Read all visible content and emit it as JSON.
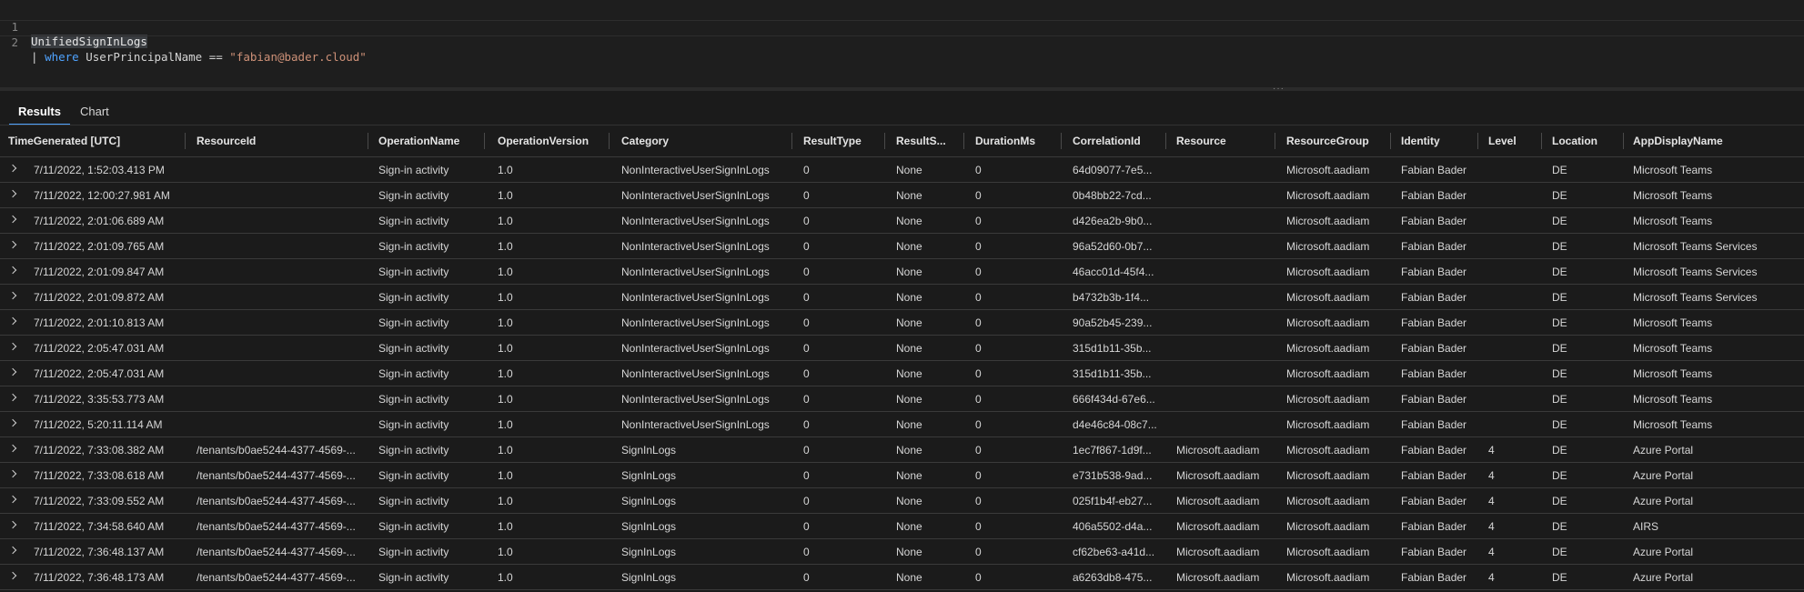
{
  "editor": {
    "lines": [
      {
        "num": "1",
        "table": "UnifiedSignInLogs"
      },
      {
        "num": "2",
        "pipe": "|",
        "keyword": "where",
        "column": "UserPrincipalName",
        "op": "==",
        "string": "\"fabian@bader.cloud\""
      }
    ]
  },
  "tabs": [
    {
      "label": "Results",
      "active": true
    },
    {
      "label": "Chart",
      "active": false
    }
  ],
  "columns": [
    "TimeGenerated [UTC]",
    "ResourceId",
    "OperationName",
    "OperationVersion",
    "Category",
    "ResultType",
    "ResultS...",
    "DurationMs",
    "CorrelationId",
    "Resource",
    "ResourceGroup",
    "Identity",
    "Level",
    "Location",
    "AppDisplayName"
  ],
  "rows": [
    [
      "7/11/2022, 1:52:03.413 PM",
      "",
      "Sign-in activity",
      "1.0",
      "NonInteractiveUserSignInLogs",
      "0",
      "None",
      "0",
      "64d09077-7e5...",
      "",
      "Microsoft.aadiam",
      "Fabian Bader",
      "",
      "DE",
      "Microsoft Teams"
    ],
    [
      "7/11/2022, 12:00:27.981 AM",
      "",
      "Sign-in activity",
      "1.0",
      "NonInteractiveUserSignInLogs",
      "0",
      "None",
      "0",
      "0b48bb22-7cd...",
      "",
      "Microsoft.aadiam",
      "Fabian Bader",
      "",
      "DE",
      "Microsoft Teams"
    ],
    [
      "7/11/2022, 2:01:06.689 AM",
      "",
      "Sign-in activity",
      "1.0",
      "NonInteractiveUserSignInLogs",
      "0",
      "None",
      "0",
      "d426ea2b-9b0...",
      "",
      "Microsoft.aadiam",
      "Fabian Bader",
      "",
      "DE",
      "Microsoft Teams"
    ],
    [
      "7/11/2022, 2:01:09.765 AM",
      "",
      "Sign-in activity",
      "1.0",
      "NonInteractiveUserSignInLogs",
      "0",
      "None",
      "0",
      "96a52d60-0b7...",
      "",
      "Microsoft.aadiam",
      "Fabian Bader",
      "",
      "DE",
      "Microsoft Teams Services"
    ],
    [
      "7/11/2022, 2:01:09.847 AM",
      "",
      "Sign-in activity",
      "1.0",
      "NonInteractiveUserSignInLogs",
      "0",
      "None",
      "0",
      "46acc01d-45f4...",
      "",
      "Microsoft.aadiam",
      "Fabian Bader",
      "",
      "DE",
      "Microsoft Teams Services"
    ],
    [
      "7/11/2022, 2:01:09.872 AM",
      "",
      "Sign-in activity",
      "1.0",
      "NonInteractiveUserSignInLogs",
      "0",
      "None",
      "0",
      "b4732b3b-1f4...",
      "",
      "Microsoft.aadiam",
      "Fabian Bader",
      "",
      "DE",
      "Microsoft Teams Services"
    ],
    [
      "7/11/2022, 2:01:10.813 AM",
      "",
      "Sign-in activity",
      "1.0",
      "NonInteractiveUserSignInLogs",
      "0",
      "None",
      "0",
      "90a52b45-239...",
      "",
      "Microsoft.aadiam",
      "Fabian Bader",
      "",
      "DE",
      "Microsoft Teams"
    ],
    [
      "7/11/2022, 2:05:47.031 AM",
      "",
      "Sign-in activity",
      "1.0",
      "NonInteractiveUserSignInLogs",
      "0",
      "None",
      "0",
      "315d1b11-35b...",
      "",
      "Microsoft.aadiam",
      "Fabian Bader",
      "",
      "DE",
      "Microsoft Teams"
    ],
    [
      "7/11/2022, 2:05:47.031 AM",
      "",
      "Sign-in activity",
      "1.0",
      "NonInteractiveUserSignInLogs",
      "0",
      "None",
      "0",
      "315d1b11-35b...",
      "",
      "Microsoft.aadiam",
      "Fabian Bader",
      "",
      "DE",
      "Microsoft Teams"
    ],
    [
      "7/11/2022, 3:35:53.773 AM",
      "",
      "Sign-in activity",
      "1.0",
      "NonInteractiveUserSignInLogs",
      "0",
      "None",
      "0",
      "666f434d-67e6...",
      "",
      "Microsoft.aadiam",
      "Fabian Bader",
      "",
      "DE",
      "Microsoft Teams"
    ],
    [
      "7/11/2022, 5:20:11.114 AM",
      "",
      "Sign-in activity",
      "1.0",
      "NonInteractiveUserSignInLogs",
      "0",
      "None",
      "0",
      "d4e46c84-08c7...",
      "",
      "Microsoft.aadiam",
      "Fabian Bader",
      "",
      "DE",
      "Microsoft Teams"
    ],
    [
      "7/11/2022, 7:33:08.382 AM",
      "/tenants/b0ae5244-4377-4569-...",
      "Sign-in activity",
      "1.0",
      "SignInLogs",
      "0",
      "None",
      "0",
      "1ec7f867-1d9f...",
      "Microsoft.aadiam",
      "Microsoft.aadiam",
      "Fabian Bader",
      "4",
      "DE",
      "Azure Portal"
    ],
    [
      "7/11/2022, 7:33:08.618 AM",
      "/tenants/b0ae5244-4377-4569-...",
      "Sign-in activity",
      "1.0",
      "SignInLogs",
      "0",
      "None",
      "0",
      "e731b538-9ad...",
      "Microsoft.aadiam",
      "Microsoft.aadiam",
      "Fabian Bader",
      "4",
      "DE",
      "Azure Portal"
    ],
    [
      "7/11/2022, 7:33:09.552 AM",
      "/tenants/b0ae5244-4377-4569-...",
      "Sign-in activity",
      "1.0",
      "SignInLogs",
      "0",
      "None",
      "0",
      "025f1b4f-eb27...",
      "Microsoft.aadiam",
      "Microsoft.aadiam",
      "Fabian Bader",
      "4",
      "DE",
      "Azure Portal"
    ],
    [
      "7/11/2022, 7:34:58.640 AM",
      "/tenants/b0ae5244-4377-4569-...",
      "Sign-in activity",
      "1.0",
      "SignInLogs",
      "0",
      "None",
      "0",
      "406a5502-d4a...",
      "Microsoft.aadiam",
      "Microsoft.aadiam",
      "Fabian Bader",
      "4",
      "DE",
      "AIRS"
    ],
    [
      "7/11/2022, 7:36:48.137 AM",
      "/tenants/b0ae5244-4377-4569-...",
      "Sign-in activity",
      "1.0",
      "SignInLogs",
      "0",
      "None",
      "0",
      "cf62be63-a41d...",
      "Microsoft.aadiam",
      "Microsoft.aadiam",
      "Fabian Bader",
      "4",
      "DE",
      "Azure Portal"
    ],
    [
      "7/11/2022, 7:36:48.173 AM",
      "/tenants/b0ae5244-4377-4569-...",
      "Sign-in activity",
      "1.0",
      "SignInLogs",
      "0",
      "None",
      "0",
      "a6263db8-475...",
      "Microsoft.aadiam",
      "Microsoft.aadiam",
      "Fabian Bader",
      "4",
      "DE",
      "Azure Portal"
    ]
  ]
}
